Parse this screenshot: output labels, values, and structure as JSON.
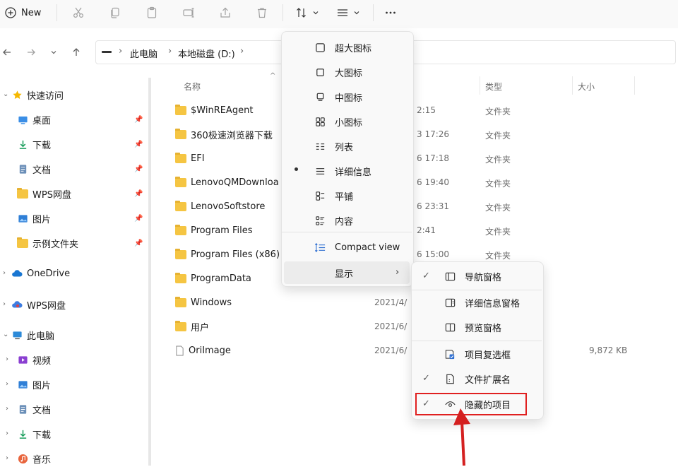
{
  "toolbar": {
    "new_label": "New"
  },
  "breadcrumb": [
    "此电脑",
    "本地磁盘 (D:)"
  ],
  "sidebar": {
    "quick_access": {
      "label": "快速访问",
      "items": [
        "桌面",
        "下载",
        "文档",
        "WPS网盘",
        "图片",
        "示例文件夹"
      ]
    },
    "onedrive": "OneDrive",
    "wps": "WPS网盘",
    "this_pc": {
      "label": "此电脑",
      "items": [
        "视频",
        "图片",
        "文档",
        "下载",
        "音乐"
      ]
    }
  },
  "columns": {
    "name": "名称",
    "type": "类型",
    "size": "大小"
  },
  "files": [
    {
      "name": "$WinREAgent",
      "date": "2:15",
      "type": "文件夹",
      "size": ""
    },
    {
      "name": "360极速浏览器下载",
      "date": "3 17:26",
      "type": "文件夹",
      "size": ""
    },
    {
      "name": "EFI",
      "date": "6 17:18",
      "type": "文件夹",
      "size": ""
    },
    {
      "name": "LenovoQMDownloa",
      "date": "6 19:40",
      "type": "文件夹",
      "size": ""
    },
    {
      "name": "LenovoSoftstore",
      "date": "6 23:31",
      "type": "文件夹",
      "size": ""
    },
    {
      "name": "Program Files",
      "date": "2:41",
      "type": "文件夹",
      "size": ""
    },
    {
      "name": "Program Files (x86)",
      "date": "6 15:00",
      "type": "文件夹",
      "size": ""
    },
    {
      "name": "ProgramData",
      "date": "",
      "type": "",
      "size": ""
    },
    {
      "name": "Windows",
      "date": "2021/4/",
      "type": "",
      "size": ""
    },
    {
      "name": "用户",
      "date": "2021/6/",
      "type": "",
      "size": ""
    },
    {
      "name": "OriImage",
      "date": "2021/6/",
      "type": "",
      "size": "9,872 KB"
    }
  ],
  "view_menu": {
    "items": [
      "超大图标",
      "大图标",
      "中图标",
      "小图标",
      "列表",
      "详细信息",
      "平铺",
      "内容"
    ],
    "compact": "Compact view",
    "show": "显示"
  },
  "show_menu": {
    "items": [
      "导航窗格",
      "详细信息窗格",
      "预览窗格",
      "项目复选框",
      "文件扩展名",
      "隐藏的项目"
    ]
  },
  "colors": {
    "highlight": "#e02020",
    "arrow": "#d42020",
    "folder": "#f5c542"
  }
}
